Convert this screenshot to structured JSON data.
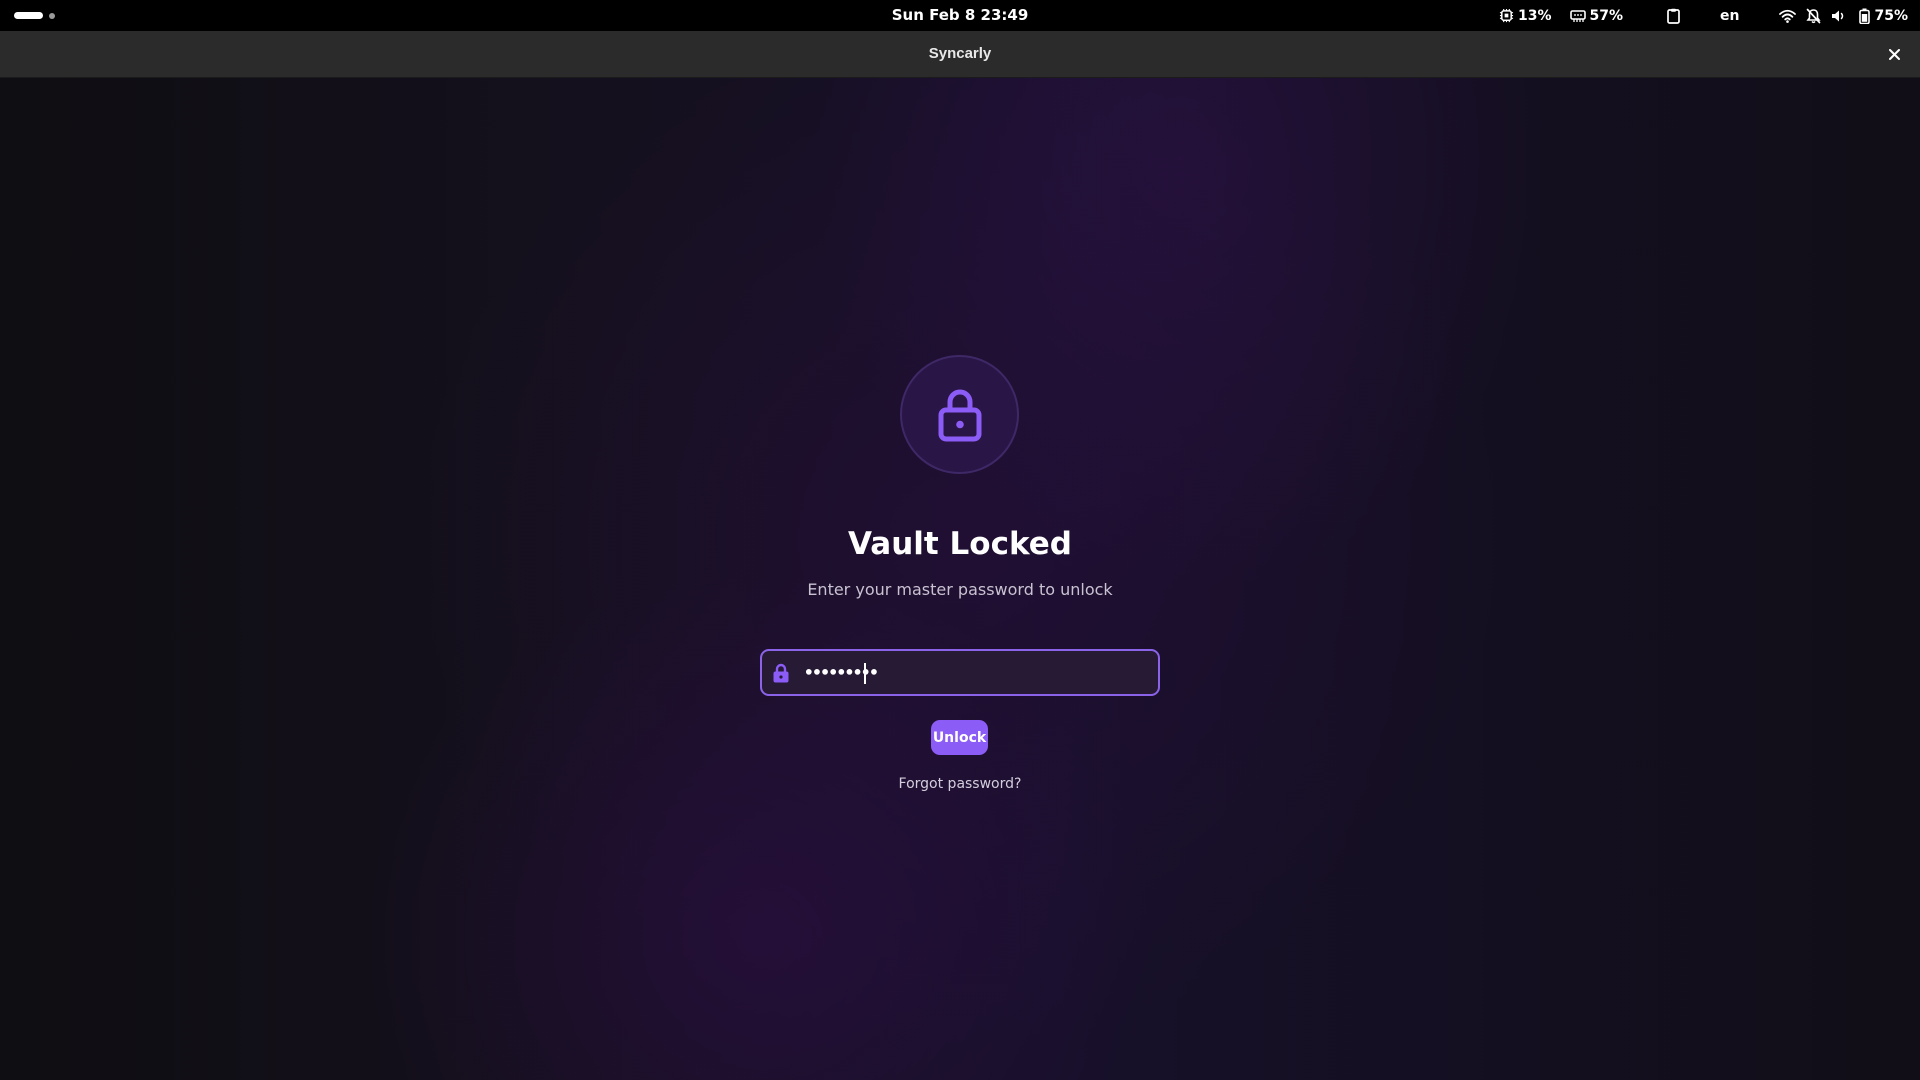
{
  "topbar": {
    "clock": "Sun Feb 8  23:49",
    "cpu_label": "13%",
    "memory_label": "57%",
    "language": "en",
    "battery_label": "75%",
    "icons": {
      "cpu": "cpu-icon",
      "memory": "memory-icon",
      "clipboard": "clipboard-icon",
      "wifi": "wifi-icon",
      "notifications": "notifications-off-icon",
      "volume": "volume-icon",
      "battery": "battery-icon"
    }
  },
  "window": {
    "title": "Syncarly",
    "close_icon": "close-icon"
  },
  "lock_screen": {
    "icon": "lock-icon",
    "title": "Vault Locked",
    "subtitle": "Enter your master password to unlock",
    "password_value": "•••••••••",
    "password_field_icon": "lock-icon",
    "unlock_label": "Unlock",
    "forgot_label": "Forgot password?"
  },
  "colors": {
    "accent": "#8b5cf6",
    "field_border": "#8a63e8",
    "icon_purple": "#8b5cf6",
    "circle_bg": "#2a1547"
  }
}
